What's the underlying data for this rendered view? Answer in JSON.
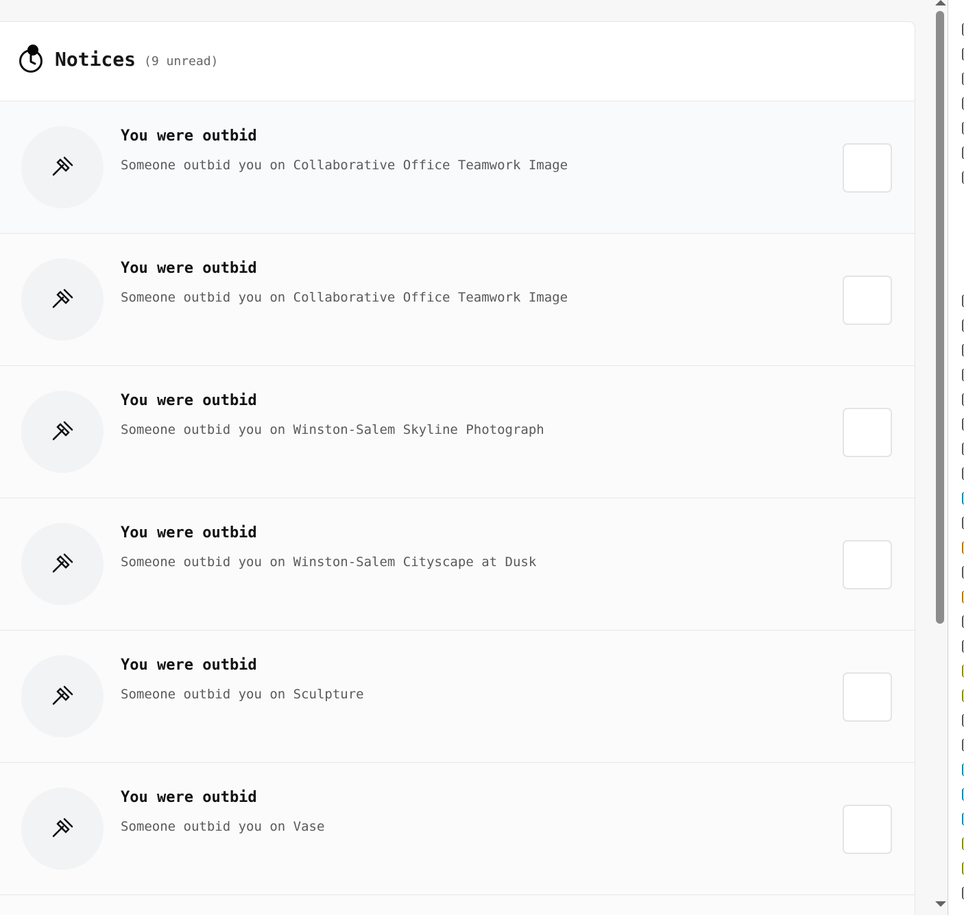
{
  "header": {
    "title": "Notices",
    "unread": "(9 unread)",
    "icon": "clock-alert-icon"
  },
  "notices": [
    {
      "title": "You were outbid",
      "body": "Someone outbid you on Collaborative Office Teamwork Image",
      "icon": "gavel-icon"
    },
    {
      "title": "You were outbid",
      "body": "Someone outbid you on Collaborative Office Teamwork Image",
      "icon": "gavel-icon"
    },
    {
      "title": "You were outbid",
      "body": "Someone outbid you on Winston-Salem Skyline Photograph",
      "icon": "gavel-icon"
    },
    {
      "title": "You were outbid",
      "body": "Someone outbid you on Winston-Salem Cityscape at Dusk",
      "icon": "gavel-icon"
    },
    {
      "title": "You were outbid",
      "body": "Someone outbid you on Sculpture",
      "icon": "gavel-icon"
    },
    {
      "title": "You were outbid",
      "body": "Someone outbid you on Vase",
      "icon": "gavel-icon"
    }
  ],
  "colors": {
    "accent": "#050505",
    "muted_text": "#5a5a5a",
    "border": "#e7e7e7"
  }
}
